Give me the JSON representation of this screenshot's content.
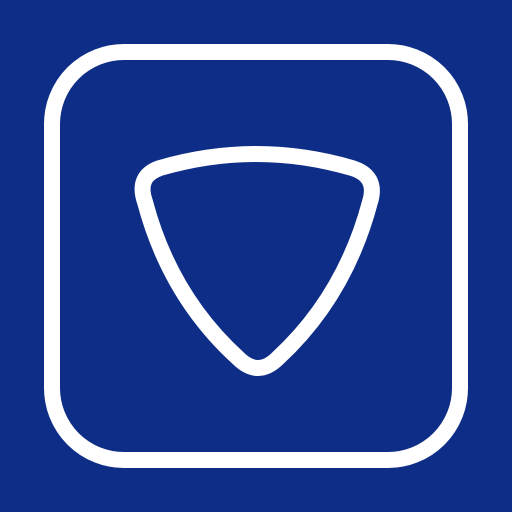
{
  "app_icon": {
    "background_color": "#0e2d87",
    "stroke_color": "#ffffff",
    "frame": "rounded-square-outline",
    "symbol": "shield-icon"
  }
}
